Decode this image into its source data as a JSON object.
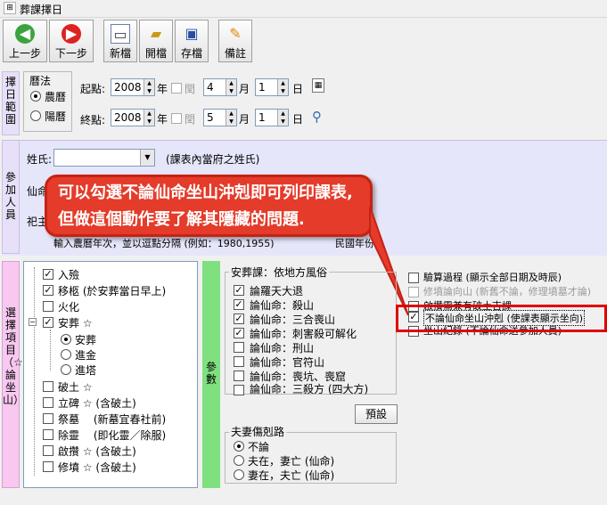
{
  "window": {
    "title": "葬課擇日"
  },
  "toolbar": {
    "prev_label": "上一步",
    "next_label": "下一步",
    "new_label": "新檔",
    "open_label": "開檔",
    "save_label": "存檔",
    "note_label": "備註"
  },
  "date_range": {
    "section_label": "擇日範圍",
    "calendar_label": "曆法",
    "lunar_label": "農曆",
    "solar_label": "陽曆",
    "start_label": "起點:",
    "end_label": "終點:",
    "start": {
      "year": "2008",
      "month": "4",
      "day": "1"
    },
    "end": {
      "year": "2008",
      "month": "5",
      "day": "1"
    },
    "year_unit": "年",
    "leap_label": "閏",
    "month_unit": "月",
    "day_unit": "日"
  },
  "participants": {
    "section_label": "參加人員",
    "surname_label": "姓氏:",
    "surname_hint": "(課表內當府之姓氏)",
    "deceased_label": "仙命",
    "host_label": "祀主",
    "hint": "輸入農曆年次，並以逗點分隔 (例如：1980,1955)",
    "hint_tail": "民國年份)"
  },
  "callout": {
    "text": "可以勾選不論仙命坐山沖剋即可列印課表, 但做這個動作要了解其隱藏的問題."
  },
  "selection": {
    "section_label": "選擇項目（☆論坐山）",
    "items": [
      {
        "label": "入殮",
        "checked": true
      },
      {
        "label": "移柩 (於安葬當日早上)",
        "checked": true
      },
      {
        "label": "火化",
        "checked": false
      },
      {
        "label": "安葬 ☆",
        "checked": true
      },
      {
        "label": "破土 ☆",
        "checked": false
      },
      {
        "label": "立碑 ☆ (含破土)",
        "checked": false
      },
      {
        "label": "祭墓　 (新墓宜春社前)",
        "checked": false
      },
      {
        "label": "除靈　 (即化靈／除服)",
        "checked": false
      },
      {
        "label": "啟攢 ☆ (含破土)",
        "checked": false
      },
      {
        "label": "修墳 ☆ (含破土)",
        "checked": false
      }
    ],
    "burial_options": [
      {
        "label": "安葬",
        "selected": true
      },
      {
        "label": "進金",
        "selected": false
      },
      {
        "label": "進塔",
        "selected": false
      }
    ]
  },
  "params": {
    "section_label": "參數",
    "feng_shui_title": "安葬課：依地方風俗",
    "feng_shui_items": [
      {
        "label": "論羅天大退",
        "checked": true
      },
      {
        "label": "論仙命：殺山",
        "checked": true
      },
      {
        "label": "論仙命：三合喪山",
        "checked": true
      },
      {
        "label": "論仙命：刺害殺可解化",
        "checked": true
      },
      {
        "label": "論仙命：刑山",
        "checked": false
      },
      {
        "label": "論仙命：官符山",
        "checked": false
      },
      {
        "label": "論仙命：喪坑、喪窟",
        "checked": false
      },
      {
        "label": "論仙命：三殺方 (四大方)",
        "checked": false
      }
    ],
    "preset_label": "預設",
    "spouse_title": "夫妻傷剋路",
    "spouse_options": [
      {
        "label": "不論",
        "selected": true
      },
      {
        "label": "夫在，妻亡 (仙命)",
        "selected": false
      },
      {
        "label": "妻在，夫亡 (仙命)",
        "selected": false
      }
    ],
    "right_options": [
      {
        "label": "驗算過程 (顯示全部日期及時辰)",
        "checked": false,
        "disabled": false
      },
      {
        "label": "修墳論向山 (新舊不論，修理墳墓才論)",
        "checked": false,
        "disabled": true
      },
      {
        "label": "啟攢需兼有破土吉課",
        "checked": false,
        "disabled": false
      },
      {
        "label": "不論仙命坐山沖剋 (使課表顯示坐向)",
        "checked": true,
        "disabled": false
      },
      {
        "label": "坐山紀錄 (不論仙命送參加人員)",
        "checked": false,
        "disabled": false
      }
    ]
  }
}
